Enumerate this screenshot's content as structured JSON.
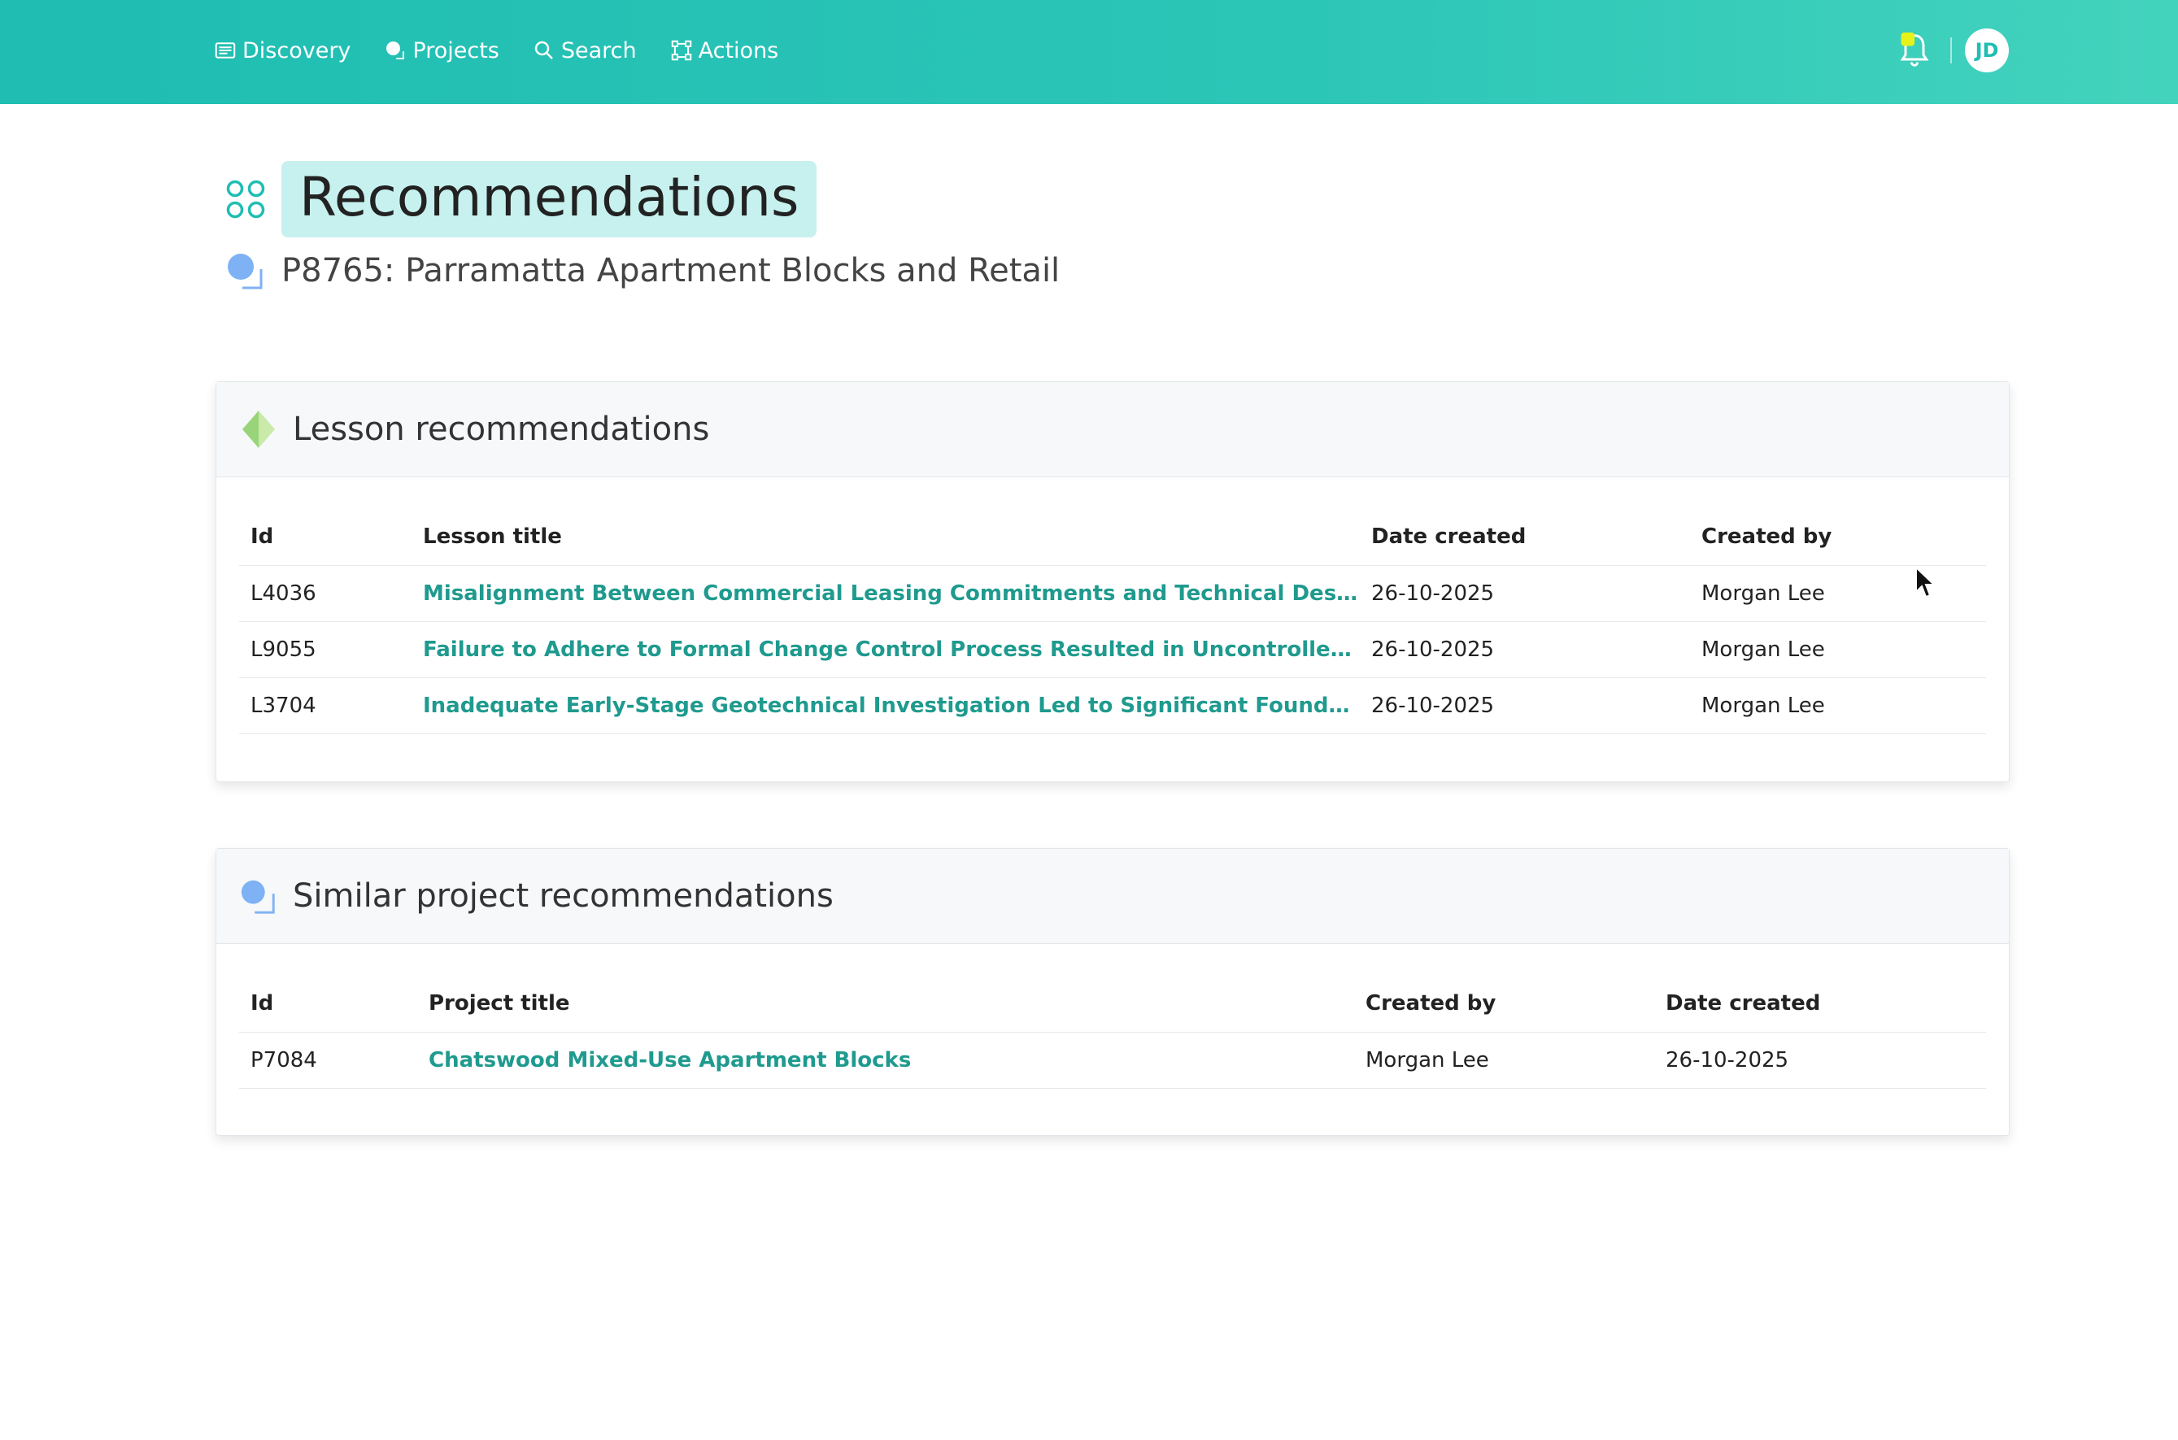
{
  "nav": {
    "items": [
      {
        "label": "Discovery",
        "icon": "newspaper-icon"
      },
      {
        "label": "Projects",
        "icon": "projects-icon"
      },
      {
        "label": "Search",
        "icon": "search-icon"
      },
      {
        "label": "Actions",
        "icon": "actions-icon"
      }
    ],
    "avatar_initials": "JD"
  },
  "page": {
    "title": "Recommendations",
    "project": "P8765: Parramatta Apartment Blocks and Retail"
  },
  "lessons": {
    "title": "Lesson recommendations",
    "columns": [
      "Id",
      "Lesson title",
      "Date created",
      "Created by"
    ],
    "rows": [
      {
        "id": "L4036",
        "title": "Misalignment Between Commercial Leasing Commitments and Technical Design Specificat...",
        "date": "26-10-2025",
        "by": "Morgan Lee"
      },
      {
        "id": "L9055",
        "title": "Failure to Adhere to Formal Change Control Process Resulted in Uncontrolled Scope Creep...",
        "date": "26-10-2025",
        "by": "Morgan Lee"
      },
      {
        "id": "L3704",
        "title": "Inadequate Early-Stage Geotechnical Investigation Led to Significant Foundation Redesign...",
        "date": "26-10-2025",
        "by": "Morgan Lee"
      }
    ]
  },
  "similar": {
    "title": "Similar project recommendations",
    "columns": [
      "Id",
      "Project title",
      "Created by",
      "Date created"
    ],
    "rows": [
      {
        "id": "P7084",
        "title": "Chatswood Mixed-Use Apartment Blocks",
        "by": "Morgan Lee",
        "date": "26-10-2025"
      }
    ]
  },
  "colors": {
    "accent": "#1fbdb2",
    "link": "#1f9a8e",
    "title_bg": "#c7f1ee"
  }
}
